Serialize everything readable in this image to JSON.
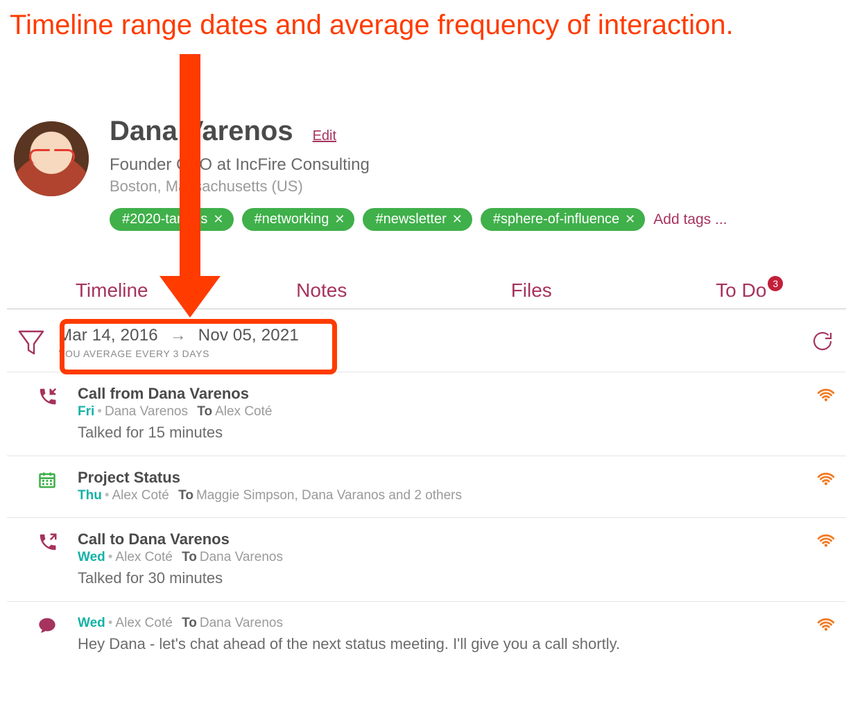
{
  "annotation": "Timeline range dates and average frequency of interaction.",
  "contact": {
    "name": "Dana Varenos",
    "edit_label": "Edit",
    "role": "Founder CEO at IncFire Consulting",
    "location": "Boston, Massachusetts (US)"
  },
  "tags": {
    "items": [
      {
        "label": "#2020-targets"
      },
      {
        "label": "#networking"
      },
      {
        "label": "#newsletter"
      },
      {
        "label": "#sphere-of-influence"
      }
    ],
    "add_label": "Add tags ..."
  },
  "tabs": {
    "timeline": "Timeline",
    "notes": "Notes",
    "files": "Files",
    "todo": "To Do",
    "todo_badge": "3"
  },
  "range": {
    "start": "Mar 14, 2016",
    "end": "Nov 05, 2021",
    "average": "YOU AVERAGE EVERY 3 DAYS"
  },
  "timeline": [
    {
      "kind": "call-in",
      "title": "Call from Dana Varenos",
      "day": "Fri",
      "from": "Dana Varenos",
      "to": "Alex Coté",
      "text": "Talked for 15 minutes"
    },
    {
      "kind": "event",
      "title": "Project Status",
      "day": "Thu",
      "from": "Alex Coté",
      "to": "Maggie Simpson, Dana Varanos and 2 others",
      "text": ""
    },
    {
      "kind": "call-out",
      "title": "Call to Dana Varenos",
      "day": "Wed",
      "from": "Alex Coté",
      "to": "Dana Varenos",
      "text": "Talked for 30 minutes"
    },
    {
      "kind": "chat",
      "title": "",
      "day": "Wed",
      "from": "Alex Coté",
      "to": "Dana Varenos",
      "text": "Hey Dana - let's chat ahead of the next status meeting. I'll give you a call shortly."
    }
  ],
  "colors": {
    "accent": "#a6335e",
    "tag_green": "#3fb04a",
    "teal": "#14b2a5",
    "wifi": "#f27b25",
    "annotation": "#ff3b00"
  }
}
